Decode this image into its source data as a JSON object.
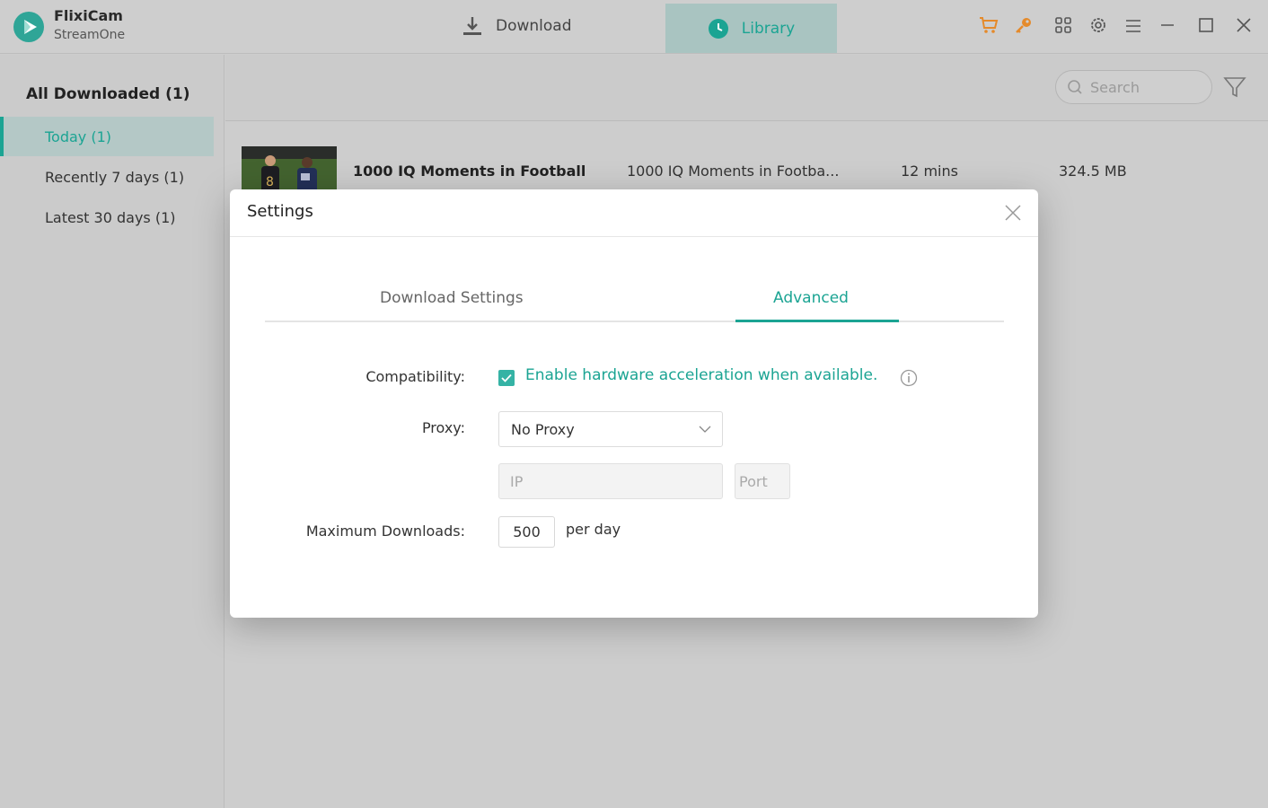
{
  "app": {
    "name": "FlixiCam",
    "subtitle": "StreamOne"
  },
  "nav": {
    "download_label": "Download",
    "library_label": "Library"
  },
  "toolbar": {
    "icons": [
      "cart-icon",
      "key-icon",
      "apps-icon",
      "gear-icon",
      "menu-icon",
      "minimize-icon",
      "maximize-icon",
      "close-icon"
    ]
  },
  "sidebar": {
    "title": "All Downloaded (1)",
    "items": [
      {
        "label": "Today (1)",
        "active": true
      },
      {
        "label": "Recently 7 days (1)",
        "active": false
      },
      {
        "label": "Latest 30 days (1)",
        "active": false
      }
    ]
  },
  "search": {
    "placeholder": "Search"
  },
  "row": {
    "title": "1000 IQ Moments in Football",
    "subtitle": "1000 IQ Moments in Footba...",
    "duration": "12 mins",
    "size": "324.5 MB"
  },
  "settings": {
    "title": "Settings",
    "tabs": {
      "download": "Download Settings",
      "advanced": "Advanced"
    },
    "compatibility_label": "Compatibility:",
    "hw_accel_text": "Enable hardware acceleration when available.",
    "hw_accel_checked": true,
    "proxy_label": "Proxy:",
    "proxy_value": "No Proxy",
    "ip_placeholder": "IP",
    "port_placeholder": "Port",
    "max_label": "Maximum Downloads:",
    "max_value": "500",
    "per_day": "per day"
  },
  "colors": {
    "accent": "#1ba493"
  }
}
